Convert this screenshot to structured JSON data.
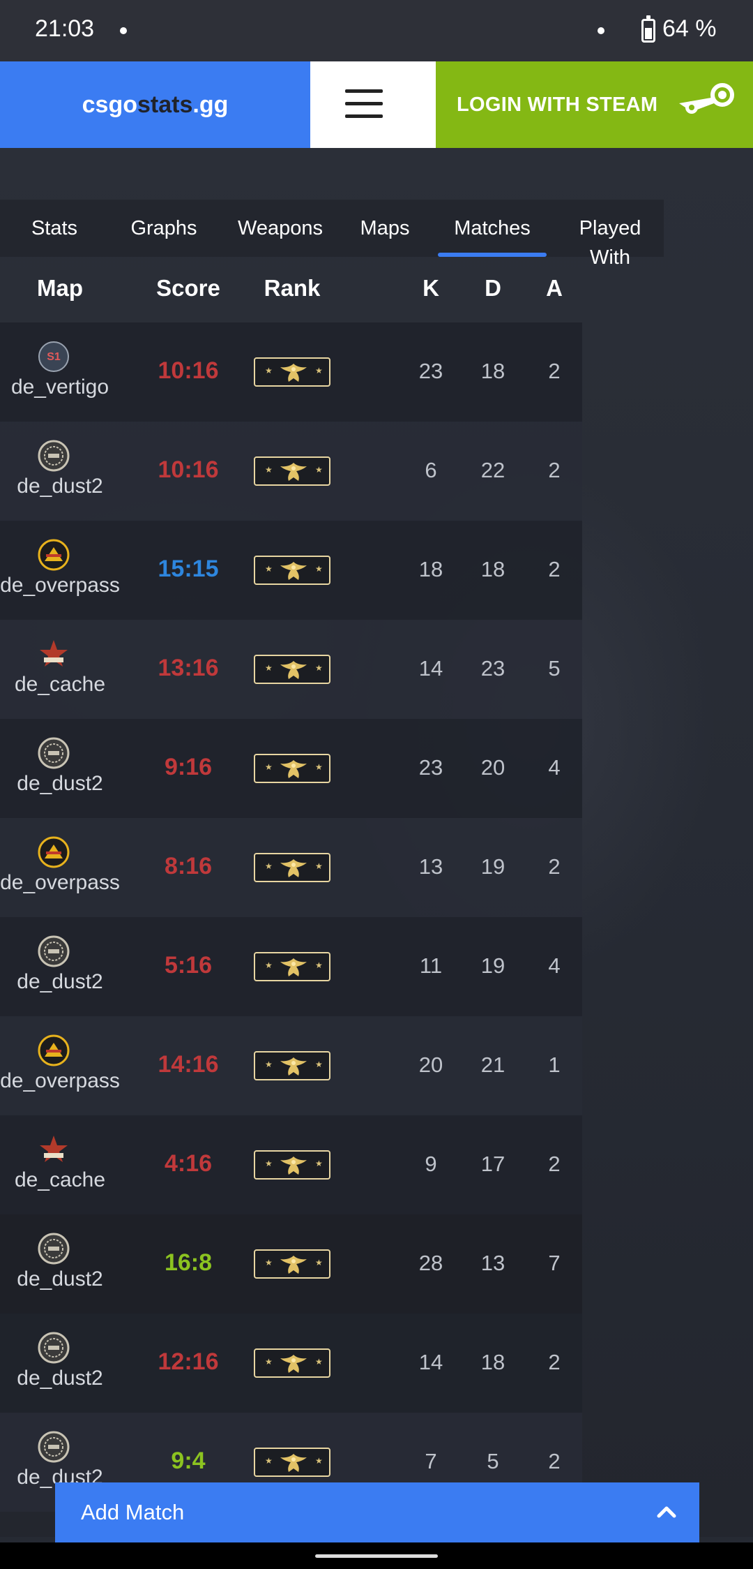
{
  "status_bar": {
    "time": "21:03",
    "battery_percent": "64 %"
  },
  "header": {
    "logo_part1": "csgo",
    "logo_part2": "stats",
    "logo_part3": ".gg",
    "menu_icon": "hamburger-menu-icon",
    "login_label": "LOGIN WITH STEAM",
    "steam_icon": "steam-logo-icon"
  },
  "tabs": [
    {
      "label": "Stats",
      "active": false
    },
    {
      "label": "Graphs",
      "active": false
    },
    {
      "label": "Weapons",
      "active": false
    },
    {
      "label": "Maps",
      "active": false
    },
    {
      "label": "Matches",
      "active": true
    },
    {
      "label": "Played\nWith",
      "active": false
    }
  ],
  "table": {
    "headers": {
      "map": "Map",
      "score": "Score",
      "rank": "Rank",
      "k": "K",
      "d": "D",
      "a": "A"
    },
    "rows": [
      {
        "map": "de_vertigo",
        "icon": "vertigo-map-icon",
        "score": "10:16",
        "result": "loss",
        "k": "23",
        "d": "18",
        "a": "2"
      },
      {
        "map": "de_dust2",
        "icon": "dust2-map-icon",
        "score": "10:16",
        "result": "loss",
        "k": "6",
        "d": "22",
        "a": "2"
      },
      {
        "map": "de_overpass",
        "icon": "overpass-map-icon",
        "score": "15:15",
        "result": "draw",
        "k": "18",
        "d": "18",
        "a": "2"
      },
      {
        "map": "de_cache",
        "icon": "cache-map-icon",
        "score": "13:16",
        "result": "loss",
        "k": "14",
        "d": "23",
        "a": "5"
      },
      {
        "map": "de_dust2",
        "icon": "dust2-map-icon",
        "score": "9:16",
        "result": "loss",
        "k": "23",
        "d": "20",
        "a": "4"
      },
      {
        "map": "de_overpass",
        "icon": "overpass-map-icon",
        "score": "8:16",
        "result": "loss",
        "k": "13",
        "d": "19",
        "a": "2"
      },
      {
        "map": "de_dust2",
        "icon": "dust2-map-icon",
        "score": "5:16",
        "result": "loss",
        "k": "11",
        "d": "19",
        "a": "4"
      },
      {
        "map": "de_overpass",
        "icon": "overpass-map-icon",
        "score": "14:16",
        "result": "loss",
        "k": "20",
        "d": "21",
        "a": "1"
      },
      {
        "map": "de_cache",
        "icon": "cache-map-icon",
        "score": "4:16",
        "result": "loss",
        "k": "9",
        "d": "17",
        "a": "2"
      },
      {
        "map": "de_dust2",
        "icon": "dust2-map-icon",
        "score": "16:8",
        "result": "win",
        "k": "28",
        "d": "13",
        "a": "7"
      },
      {
        "map": "de_dust2",
        "icon": "dust2-map-icon",
        "score": "12:16",
        "result": "loss",
        "k": "14",
        "d": "18",
        "a": "2"
      },
      {
        "map": "de_dust2",
        "icon": "dust2-map-icon",
        "score": "9:4",
        "result": "win",
        "k": "7",
        "d": "5",
        "a": "2"
      }
    ],
    "rank_icon": "gold-eagle-rank-icon"
  },
  "footer": {
    "add_match_label": "Add Match",
    "chevron_icon": "chevron-up-icon"
  },
  "colors": {
    "accent_blue": "#3b7cf2",
    "steam_green": "#84b814",
    "loss": "#c0393b",
    "draw": "#2e86de",
    "win": "#8cc320"
  }
}
